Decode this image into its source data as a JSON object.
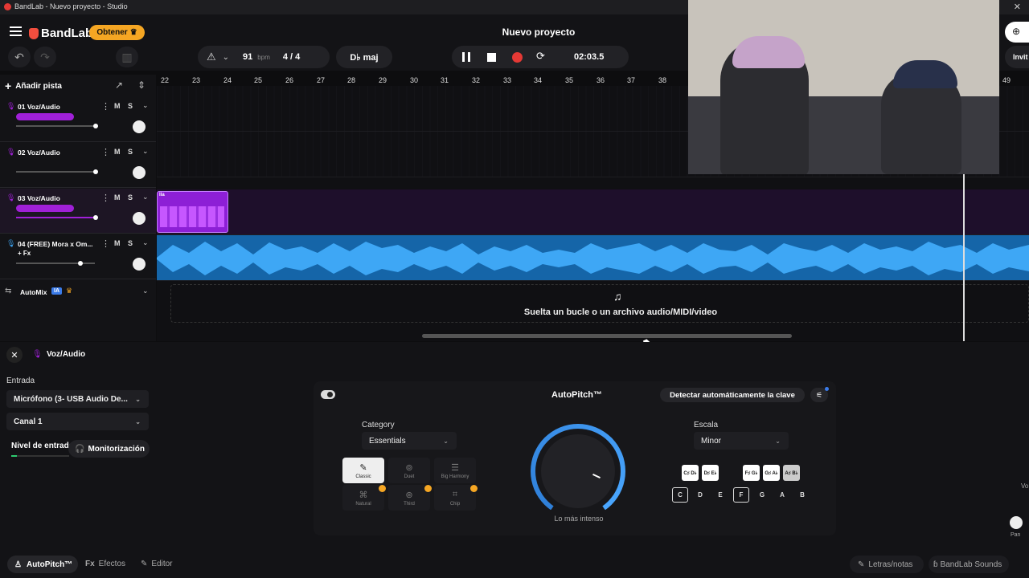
{
  "window": {
    "title": "BandLab - Nuevo proyecto - Studio"
  },
  "header": {
    "brand": "BandLab",
    "get_button": "Obtener",
    "project_name": "Nuevo proyecto",
    "right_partial_label": "Invit"
  },
  "transport": {
    "bpm_value": "91",
    "bpm_unit": "bpm",
    "time_signature": "4 / 4",
    "key": "D♭ maj",
    "time": "02:03.5"
  },
  "toolbar": {
    "add_track": "Añadir pista"
  },
  "ruler": {
    "bars": [
      "22",
      "23",
      "24",
      "25",
      "26",
      "27",
      "28",
      "29",
      "30",
      "31",
      "32",
      "33",
      "34",
      "35",
      "36",
      "37",
      "38"
    ],
    "far_bar": "49"
  },
  "tracks": [
    {
      "number": "01",
      "name": "Voz/Audio",
      "color": "#a020d8",
      "fx": ""
    },
    {
      "number": "02",
      "name": "Voz/Audio",
      "color": "#a020d8",
      "fx": ""
    },
    {
      "number": "03",
      "name": "Voz/Audio",
      "color": "#a020d8",
      "fx": ""
    },
    {
      "number": "04",
      "name": "(FREE) Mora x Om...",
      "color": "#3b9ee8",
      "fx": "+ Fx"
    }
  ],
  "track_buttons": {
    "mute": "M",
    "solo": "S"
  },
  "automix": {
    "label": "AutoMix",
    "badge": "IA"
  },
  "clip": {
    "label": "lla"
  },
  "dropzone": {
    "text": "Suelta un bucle o un archivo audio/MIDI/video"
  },
  "panel": {
    "track_name": "Voz/Audio",
    "input_label": "Entrada",
    "input_device": "Micrófono (3- USB Audio De...",
    "channel": "Canal 1",
    "level_label": "Nivel de entrada",
    "monitor_button": "Monitorización",
    "pan_label": "Pan",
    "right_partial_label": "Vo"
  },
  "autopitch": {
    "title": "AutoPitch™",
    "detect_button": "Detectar automáticamente la clave",
    "category_label": "Category",
    "category_value": "Essentials",
    "scale_label": "Escala",
    "scale_value": "Minor",
    "knob_label": "Lo más intenso",
    "effects": [
      {
        "name": "Classic",
        "selected": true
      },
      {
        "name": "Duet",
        "selected": false
      },
      {
        "name": "Big Harmony",
        "selected": false
      },
      {
        "name": "Natural",
        "selected": false
      },
      {
        "name": "Third",
        "selected": false
      },
      {
        "name": "Chip",
        "selected": false
      }
    ],
    "sharp_keys": [
      "C♯ D♭",
      "D♯ E♭",
      "F♯ G♭",
      "G♯ A♭",
      "A♯ B♭"
    ],
    "natural_keys": [
      "C",
      "D",
      "E",
      "F",
      "G",
      "A",
      "B"
    ]
  },
  "bottom": {
    "autopitch_tab": "AutoPitch™",
    "effects_tab": "Efectos",
    "effects_prefix": "Fx",
    "editor_tab": "Editor",
    "lyrics_tab": "Letras/notas",
    "sounds_tab": "BandLab Sounds"
  },
  "colors": {
    "accent_purple": "#a020d8",
    "audio_blue": "#3b9ee8",
    "brand_red": "#f24e3e",
    "record_red": "#e53935",
    "premium_gold": "#f5a623"
  }
}
